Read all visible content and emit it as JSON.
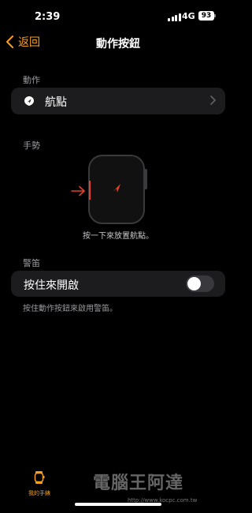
{
  "status_bar": {
    "time": "2:39",
    "network": "4G",
    "battery": "93"
  },
  "nav": {
    "back_label": "返回",
    "title": "動作按鈕"
  },
  "action_section": {
    "label": "動作",
    "item_label": "航點"
  },
  "gesture_section": {
    "label": "手勢",
    "hint": "按一下來放置航點。"
  },
  "siren_section": {
    "label": "警笛",
    "toggle_label": "按住來開啟",
    "toggle_on": false,
    "footnote": "按住動作按鈕來啟用警笛。"
  },
  "tab_bar": {
    "tab_label": "我的手錶"
  },
  "watermark": {
    "text": "電腦王阿達",
    "url": "http://www.kocpc.com.tw"
  },
  "colors": {
    "accent": "#f7a01e",
    "highlight": "#e2412b",
    "card": "#1c1c1e"
  }
}
